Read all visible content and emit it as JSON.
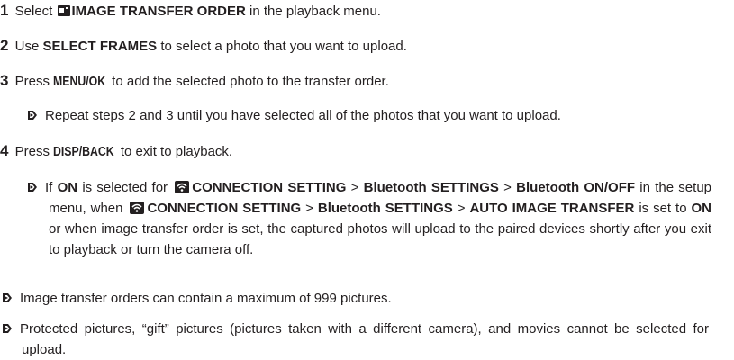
{
  "steps": [
    {
      "number": "1",
      "text_before": "Select",
      "bold": "IMAGE TRANSFER ORDER",
      "text_after": "in the playback menu.",
      "icon": "image-transfer-icon"
    },
    {
      "number": "2",
      "text_before": "Use",
      "bold": "SELECT FRAMES",
      "text_after": "to select a photo that you want to upload."
    },
    {
      "number": "3",
      "text_before": "Press",
      "bold": "MENU/OK",
      "text_after": "to add the selected photo to the transfer order."
    },
    {
      "number": "4",
      "text_before": "Press",
      "bold": "DISP/BACK",
      "text_after": "to exit to playback."
    }
  ],
  "note_step3": "Repeat steps 2 and 3 until you have selected all of the photos that you want to upload.",
  "note_step4": {
    "t1": "If",
    "b1": "ON",
    "t2": "is selected for",
    "b2": "CONNECTION SETTING",
    "t3": ">",
    "b3": "Bluetooth SETTINGS",
    "t4": ">",
    "b4": "Bluetooth ON/OFF",
    "t5": "in the setup menu, when",
    "b5": "CONNECTION SETTING",
    "t6": ">",
    "b6": "Bluetooth SETTINGS",
    "t7": ">",
    "b7": "AUTO IMAGE TRANSFER",
    "t8": "is set to",
    "b8": "ON",
    "t9": "or when image transfer order is set, the captured photos will upload to the paired devices shortly after you exit to playback or turn the camera off.",
    "icon": "wireless-icon"
  },
  "notes": [
    "Image transfer orders can contain a maximum of 999 pictures.",
    "Protected pictures, “gift” pictures (pictures taken with a different camera), and movies cannot be selected for upload."
  ],
  "colors": {
    "text": "#231f20",
    "background": "#ffffff"
  }
}
